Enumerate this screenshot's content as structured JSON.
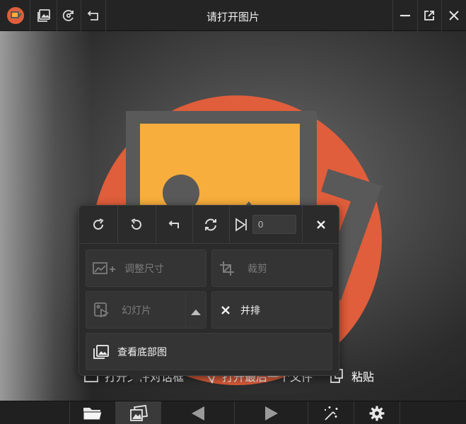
{
  "window": {
    "title": "请打开图片"
  },
  "titlebar": {
    "left_icons": [
      "app-logo-icon",
      "gallery-icon",
      "rotate-refresh-icon",
      "undo-icon"
    ],
    "right_icons": [
      "minimize-icon",
      "popout-icon",
      "close-icon"
    ]
  },
  "popup": {
    "toolbar_icons": [
      "rotate-right-icon",
      "rotate-left-icon",
      "undo-icon",
      "refresh-icon",
      "skip-to-frame-icon",
      "close-icon"
    ],
    "frame_value": "0",
    "buttons": {
      "resize": "调整尺寸",
      "crop": "裁剪",
      "slideshow": "幻灯片",
      "side_by_side": "并排",
      "view_bottom": "查看底部图"
    }
  },
  "hints": {
    "open_dialog": "打开文件对话框",
    "open_recent": "打开最后一个文件",
    "paste": "粘贴"
  },
  "bottombar": {
    "icons": [
      "folder-icon",
      "gallery-icon",
      "previous-icon",
      "next-icon",
      "magic-wand-icon",
      "gear-icon"
    ]
  },
  "colors": {
    "accent_orange": "#E05E3B",
    "image_yellow": "#F7AE3C",
    "frame_gray": "#595959"
  }
}
